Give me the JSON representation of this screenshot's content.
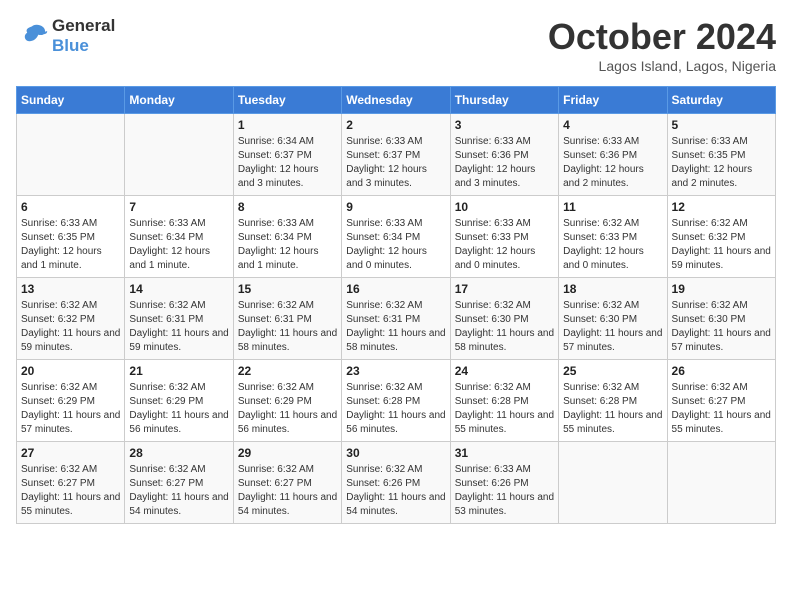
{
  "header": {
    "logo_line1": "General",
    "logo_line2": "Blue",
    "month": "October 2024",
    "location": "Lagos Island, Lagos, Nigeria"
  },
  "weekdays": [
    "Sunday",
    "Monday",
    "Tuesday",
    "Wednesday",
    "Thursday",
    "Friday",
    "Saturday"
  ],
  "weeks": [
    [
      {
        "day": "",
        "info": ""
      },
      {
        "day": "",
        "info": ""
      },
      {
        "day": "1",
        "info": "Sunrise: 6:34 AM\nSunset: 6:37 PM\nDaylight: 12 hours and 3 minutes."
      },
      {
        "day": "2",
        "info": "Sunrise: 6:33 AM\nSunset: 6:37 PM\nDaylight: 12 hours and 3 minutes."
      },
      {
        "day": "3",
        "info": "Sunrise: 6:33 AM\nSunset: 6:36 PM\nDaylight: 12 hours and 3 minutes."
      },
      {
        "day": "4",
        "info": "Sunrise: 6:33 AM\nSunset: 6:36 PM\nDaylight: 12 hours and 2 minutes."
      },
      {
        "day": "5",
        "info": "Sunrise: 6:33 AM\nSunset: 6:35 PM\nDaylight: 12 hours and 2 minutes."
      }
    ],
    [
      {
        "day": "6",
        "info": "Sunrise: 6:33 AM\nSunset: 6:35 PM\nDaylight: 12 hours and 1 minute."
      },
      {
        "day": "7",
        "info": "Sunrise: 6:33 AM\nSunset: 6:34 PM\nDaylight: 12 hours and 1 minute."
      },
      {
        "day": "8",
        "info": "Sunrise: 6:33 AM\nSunset: 6:34 PM\nDaylight: 12 hours and 1 minute."
      },
      {
        "day": "9",
        "info": "Sunrise: 6:33 AM\nSunset: 6:34 PM\nDaylight: 12 hours and 0 minutes."
      },
      {
        "day": "10",
        "info": "Sunrise: 6:33 AM\nSunset: 6:33 PM\nDaylight: 12 hours and 0 minutes."
      },
      {
        "day": "11",
        "info": "Sunrise: 6:32 AM\nSunset: 6:33 PM\nDaylight: 12 hours and 0 minutes."
      },
      {
        "day": "12",
        "info": "Sunrise: 6:32 AM\nSunset: 6:32 PM\nDaylight: 11 hours and 59 minutes."
      }
    ],
    [
      {
        "day": "13",
        "info": "Sunrise: 6:32 AM\nSunset: 6:32 PM\nDaylight: 11 hours and 59 minutes."
      },
      {
        "day": "14",
        "info": "Sunrise: 6:32 AM\nSunset: 6:31 PM\nDaylight: 11 hours and 59 minutes."
      },
      {
        "day": "15",
        "info": "Sunrise: 6:32 AM\nSunset: 6:31 PM\nDaylight: 11 hours and 58 minutes."
      },
      {
        "day": "16",
        "info": "Sunrise: 6:32 AM\nSunset: 6:31 PM\nDaylight: 11 hours and 58 minutes."
      },
      {
        "day": "17",
        "info": "Sunrise: 6:32 AM\nSunset: 6:30 PM\nDaylight: 11 hours and 58 minutes."
      },
      {
        "day": "18",
        "info": "Sunrise: 6:32 AM\nSunset: 6:30 PM\nDaylight: 11 hours and 57 minutes."
      },
      {
        "day": "19",
        "info": "Sunrise: 6:32 AM\nSunset: 6:30 PM\nDaylight: 11 hours and 57 minutes."
      }
    ],
    [
      {
        "day": "20",
        "info": "Sunrise: 6:32 AM\nSunset: 6:29 PM\nDaylight: 11 hours and 57 minutes."
      },
      {
        "day": "21",
        "info": "Sunrise: 6:32 AM\nSunset: 6:29 PM\nDaylight: 11 hours and 56 minutes."
      },
      {
        "day": "22",
        "info": "Sunrise: 6:32 AM\nSunset: 6:29 PM\nDaylight: 11 hours and 56 minutes."
      },
      {
        "day": "23",
        "info": "Sunrise: 6:32 AM\nSunset: 6:28 PM\nDaylight: 11 hours and 56 minutes."
      },
      {
        "day": "24",
        "info": "Sunrise: 6:32 AM\nSunset: 6:28 PM\nDaylight: 11 hours and 55 minutes."
      },
      {
        "day": "25",
        "info": "Sunrise: 6:32 AM\nSunset: 6:28 PM\nDaylight: 11 hours and 55 minutes."
      },
      {
        "day": "26",
        "info": "Sunrise: 6:32 AM\nSunset: 6:27 PM\nDaylight: 11 hours and 55 minutes."
      }
    ],
    [
      {
        "day": "27",
        "info": "Sunrise: 6:32 AM\nSunset: 6:27 PM\nDaylight: 11 hours and 55 minutes."
      },
      {
        "day": "28",
        "info": "Sunrise: 6:32 AM\nSunset: 6:27 PM\nDaylight: 11 hours and 54 minutes."
      },
      {
        "day": "29",
        "info": "Sunrise: 6:32 AM\nSunset: 6:27 PM\nDaylight: 11 hours and 54 minutes."
      },
      {
        "day": "30",
        "info": "Sunrise: 6:32 AM\nSunset: 6:26 PM\nDaylight: 11 hours and 54 minutes."
      },
      {
        "day": "31",
        "info": "Sunrise: 6:33 AM\nSunset: 6:26 PM\nDaylight: 11 hours and 53 minutes."
      },
      {
        "day": "",
        "info": ""
      },
      {
        "day": "",
        "info": ""
      }
    ]
  ]
}
